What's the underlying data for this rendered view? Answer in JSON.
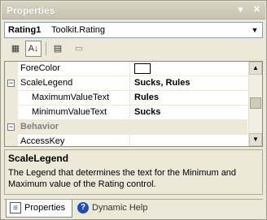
{
  "window": {
    "title": "Properties"
  },
  "selector": {
    "object_name": "Rating1",
    "object_type": "Toolkit.Rating"
  },
  "toolbar": {
    "categorized_icon": "▦",
    "alpha_icon": "A↓",
    "properties_icon": "▤",
    "events_icon": "▭"
  },
  "grid": {
    "rows": [
      {
        "name": "ForeColor",
        "value": "",
        "type": "color"
      },
      {
        "name": "ScaleLegend",
        "value": "Sucks, Rules",
        "type": "expanded",
        "toggle": "−"
      },
      {
        "name": "MaximumValueText",
        "value": "Rules",
        "type": "sub"
      },
      {
        "name": "MinimumValueText",
        "value": "Sucks",
        "type": "sub"
      },
      {
        "name": "Behavior",
        "value": "",
        "type": "category",
        "toggle": "−"
      },
      {
        "name": "AccessKey",
        "value": "",
        "type": "normal"
      }
    ]
  },
  "description": {
    "title": "ScaleLegend",
    "text": "The Legend that determines the text for the Minimum and Maximum value of the Rating control."
  },
  "tabs": {
    "properties": "Properties",
    "dynamic_help": "Dynamic Help"
  }
}
